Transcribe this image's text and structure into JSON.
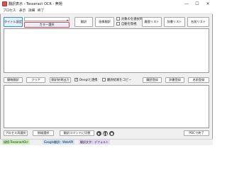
{
  "window": {
    "title": "翻訳表示 - Tesseract OCR - 無題",
    "minimize": "—",
    "maximize": "☐",
    "close": "✕"
  },
  "menu": [
    "プロセス",
    "表示",
    "詳細",
    "終了"
  ],
  "toolbar": {
    "title_setting": "タイトル設定",
    "combo_value": "",
    "color_select": "カラー選択",
    "translate": "翻訳",
    "image_translate": "画像翻訳",
    "checkbox_top": {
      "label": "対象のを選択時",
      "checked": false
    },
    "checkbox_bottom": {
      "label": "自動を無視",
      "checked": false
    },
    "history_list": "履歴リスト",
    "dictionary_list": "辞書リスト",
    "name_list": "名前リスト"
  },
  "midbar": {
    "shortcut_translate": "簡略翻訳",
    "clear": "クリア",
    "output": "翻訳結果出力",
    "deepl_check": {
      "label": "Deeplと連携",
      "checked": true
    },
    "copy_check": {
      "label": "翻訳結果をコピー",
      "checked": false
    },
    "history_register": "履歴登録",
    "dictionary_register": "辞書登録",
    "name_register": "名前登録"
  },
  "bottombar": {
    "process_reselect": "プロセス再選択",
    "target_capture": "領域選択",
    "switch_command": "翻訳コマンドに切替",
    "poc_quit": "POCで終了"
  },
  "status": {
    "ocr": "接続:TesseractOcr",
    "translator": "Google翻訳：WebAPI",
    "mode": "翻訳文字：デフォルト"
  },
  "colors": {
    "highlight": "#e0484f",
    "arrow": "#e8202a",
    "status_ocr": "#c9f0b8",
    "status_translator": "#cfe3fb",
    "status_mode": "#e4d7f7"
  }
}
